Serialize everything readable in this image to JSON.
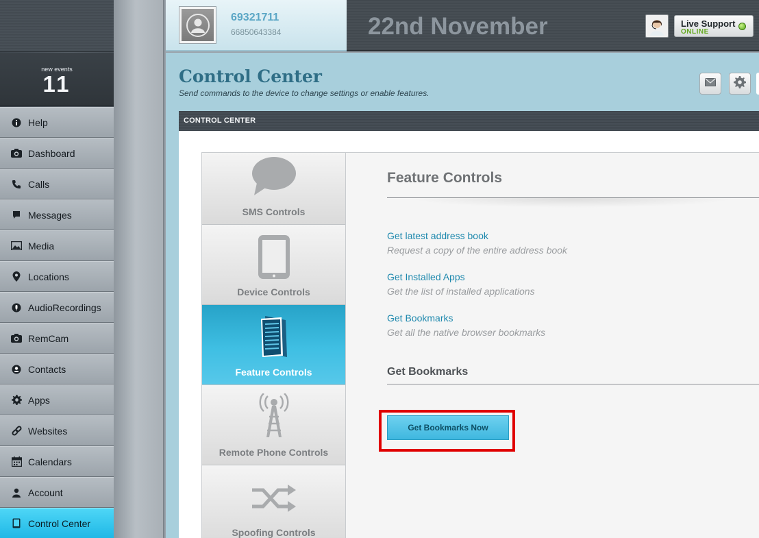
{
  "events": {
    "label": "new events",
    "count": "11"
  },
  "nav": {
    "items": [
      {
        "label": "Help",
        "icon": "info-icon"
      },
      {
        "label": "Dashboard",
        "icon": "camera-icon"
      },
      {
        "label": "Calls",
        "icon": "phone-icon"
      },
      {
        "label": "Messages",
        "icon": "message-icon"
      },
      {
        "label": "Media",
        "icon": "image-icon"
      },
      {
        "label": "Locations",
        "icon": "location-pin-icon"
      },
      {
        "label": "AudioRecordings",
        "icon": "microphone-icon"
      },
      {
        "label": "RemCam",
        "icon": "camera-icon"
      },
      {
        "label": "Contacts",
        "icon": "contacts-icon"
      },
      {
        "label": "Apps",
        "icon": "gear-icon"
      },
      {
        "label": "Websites",
        "icon": "link-icon"
      },
      {
        "label": "Calendars",
        "icon": "calendar-icon"
      },
      {
        "label": "Account",
        "icon": "user-icon"
      },
      {
        "label": "Control Center",
        "icon": "tablet-icon",
        "active": true
      }
    ]
  },
  "user": {
    "id": "69321711",
    "phone": "66850643384"
  },
  "header": {
    "date": "22nd November"
  },
  "live_support": {
    "title": "Live Support",
    "status": "ONLINE"
  },
  "page": {
    "title": "Control Center",
    "subtitle": "Send commands to the device to change settings or enable features."
  },
  "panel": {
    "title": "CONTROL CENTER"
  },
  "tabs": [
    {
      "label": "SMS Controls",
      "icon": "speech-bubble-icon"
    },
    {
      "label": "Device Controls",
      "icon": "tablet-icon"
    },
    {
      "label": "Feature Controls",
      "icon": "document-icon",
      "active": true
    },
    {
      "label": "Remote Phone Controls",
      "icon": "antenna-icon"
    },
    {
      "label": "Spoofing Controls",
      "icon": "shuffle-icon"
    }
  ],
  "content": {
    "title": "Feature Controls",
    "features": [
      {
        "link": "Get latest address book",
        "desc": "Request a copy of the entire address book"
      },
      {
        "link": "Get Installed Apps",
        "desc": "Get the list of installed applications"
      },
      {
        "link": "Get Bookmarks",
        "desc": "Get all the native browser bookmarks"
      }
    ],
    "section_title": "Get Bookmarks",
    "button_label": "Get Bookmarks Now"
  },
  "colors": {
    "accent": "#3fbfe3",
    "link": "#1d88ad",
    "highlight": "#e00000",
    "online": "#62a81e"
  }
}
